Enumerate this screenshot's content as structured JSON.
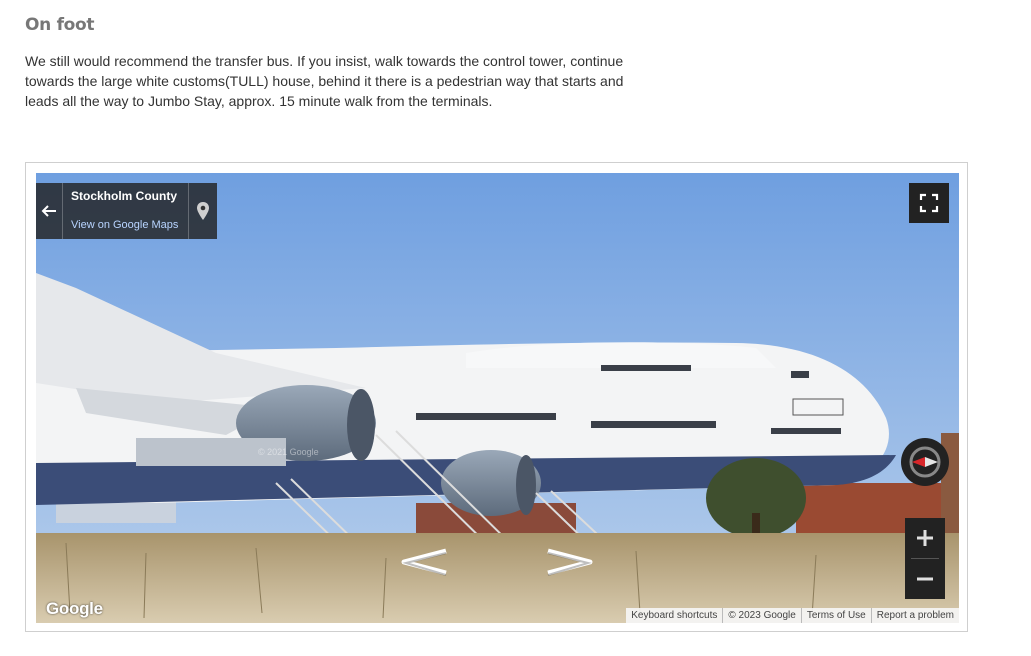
{
  "section": {
    "heading": "On foot",
    "paragraph": "We still would recommend the transfer bus. If you insist, walk towards the control tower, continue towards the large white customs(TULL) house, behind it there is a pedestrian way that starts and leads all the way to Jumbo Stay, approx. 15 minute walk from the terminals."
  },
  "streetview": {
    "info": {
      "place": "Stockholm County",
      "link": "View on Google Maps"
    },
    "watermark": "© 2021 Google",
    "logo": "Google",
    "footer": {
      "shortcuts": "Keyboard shortcuts",
      "copyright": "© 2023 Google",
      "terms": "Terms of Use",
      "report": "Report a problem"
    },
    "icons": {
      "back": "arrow-left-icon",
      "pin": "map-pin-icon",
      "fullscreen": "fullscreen-icon",
      "compass": "compass-icon",
      "zoom_in": "plus-icon",
      "zoom_out": "minus-icon",
      "nav_left": "chevron-left-icon",
      "nav_right": "chevron-right-icon"
    }
  }
}
